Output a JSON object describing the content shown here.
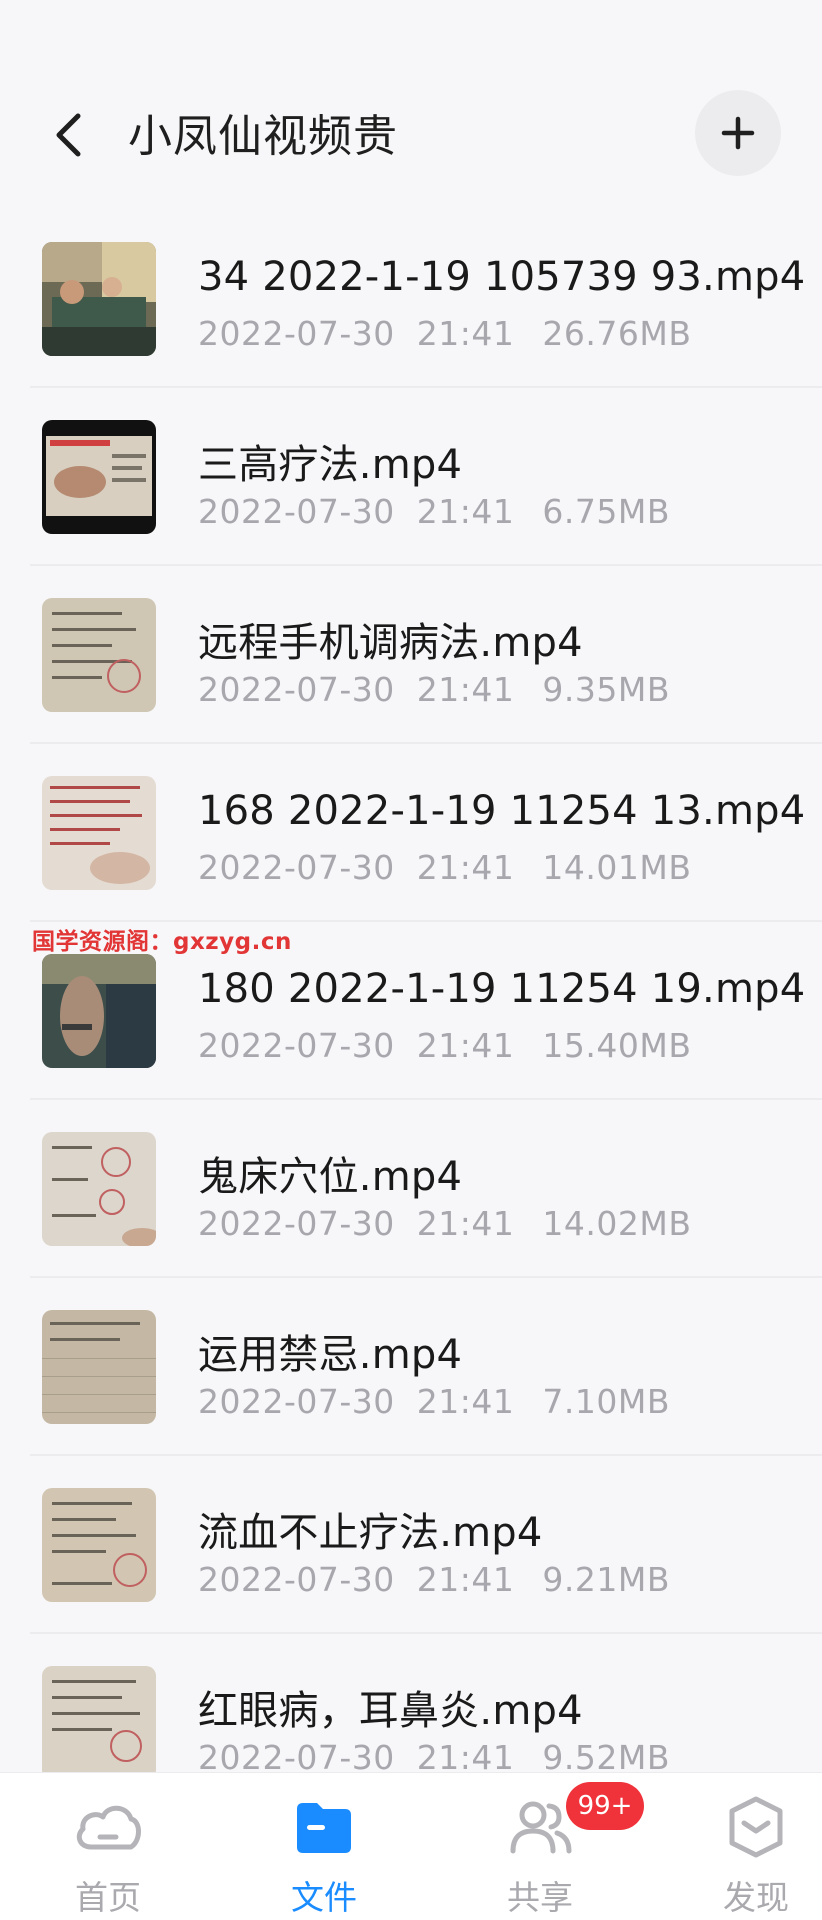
{
  "header": {
    "title": "小凤仙视频贵",
    "back_icon": "chevron-left-icon",
    "add_icon": "plus-icon"
  },
  "files": [
    {
      "name": "34 2022-1-19 105739 93.mp4",
      "date": "2022-07-30",
      "time": "21:41",
      "size": "26.76MB"
    },
    {
      "name": "三高疗法.mp4",
      "date": "2022-07-30",
      "time": "21:41",
      "size": "6.75MB"
    },
    {
      "name": "远程手机调病法.mp4",
      "date": "2022-07-30",
      "time": "21:41",
      "size": "9.35MB"
    },
    {
      "name": "168 2022-1-19 11254 13.mp4",
      "date": "2022-07-30",
      "time": "21:41",
      "size": "14.01MB"
    },
    {
      "name": "180 2022-1-19 11254 19.mp4",
      "date": "2022-07-30",
      "time": "21:41",
      "size": "15.40MB"
    },
    {
      "name": "鬼床穴位.mp4",
      "date": "2022-07-30",
      "time": "21:41",
      "size": "14.02MB"
    },
    {
      "name": "运用禁忌.mp4",
      "date": "2022-07-30",
      "time": "21:41",
      "size": "7.10MB"
    },
    {
      "name": "流血不止疗法.mp4",
      "date": "2022-07-30",
      "time": "21:41",
      "size": "9.21MB"
    },
    {
      "name": "红眼病，耳鼻炎.mp4",
      "date": "2022-07-30",
      "time": "21:41",
      "size": "9.52MB"
    }
  ],
  "watermark": "国学资源阁：gxzyg.cn",
  "nav": {
    "items": [
      {
        "label": "首页",
        "icon": "cloud-icon",
        "active": false
      },
      {
        "label": "文件",
        "icon": "folder-icon",
        "active": true
      },
      {
        "label": "共享",
        "icon": "people-icon",
        "active": false
      },
      {
        "label": "发现",
        "icon": "discover-icon",
        "active": false
      }
    ],
    "badge": "99+"
  },
  "colors": {
    "accent": "#1a8cff",
    "badge": "#f0333a",
    "watermark": "#e23535"
  }
}
